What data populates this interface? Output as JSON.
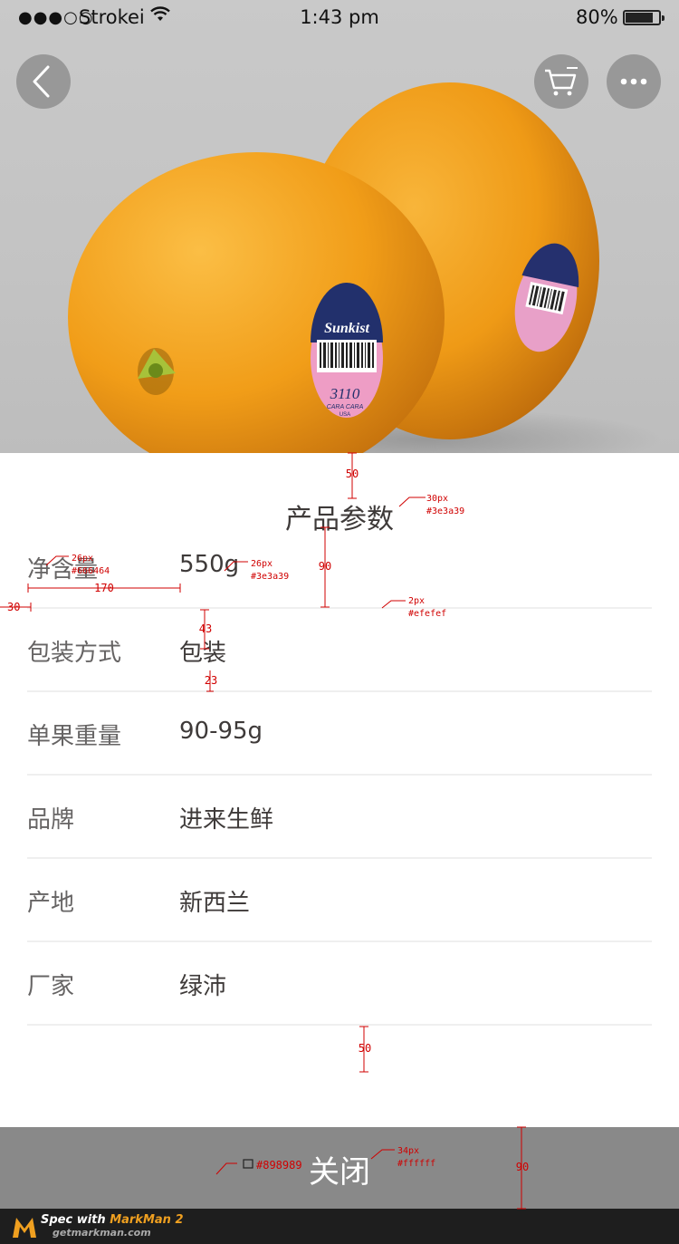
{
  "status_bar": {
    "signal": "●●●○○",
    "carrier": "Strokei",
    "time": "1:43 pm",
    "battery": "80%"
  },
  "hero": {
    "label_brand": "Sunkist",
    "label_code": "3110",
    "label_variety": "CARA CARA",
    "label_origin": "USA"
  },
  "header_buttons": [
    "back-icon",
    "cart-icon",
    "more-icon"
  ],
  "sheet": {
    "title": "产品参数",
    "rows": [
      {
        "label": "净含量",
        "value": "550g"
      },
      {
        "label": "包装方式",
        "value": "包装"
      },
      {
        "label": "单果重量",
        "value": "90-95g"
      },
      {
        "label": "品牌",
        "value": "进来生鲜"
      },
      {
        "label": "产地",
        "value": "新西兰"
      },
      {
        "label": "厂家",
        "value": "绿沛"
      }
    ]
  },
  "close_button": {
    "label": "关闭"
  },
  "footer": {
    "line1_prefix": "Spec with",
    "line1_brand": "MarkMan 2",
    "line2": "getmarkman.com"
  },
  "annotations": {
    "top_gap": "50",
    "title_spec_size": "30px",
    "title_spec_color": "#3e3a39",
    "title_row_gap": "90",
    "label_spec_size": "26px",
    "label_spec_color": "#666464",
    "value_spec_size": "26px",
    "value_spec_color": "#3e3a39",
    "value_offset": "170",
    "side_margin": "30",
    "divider_spec_size": "2px",
    "divider_spec_color": "#efefef",
    "value_top_gap": "43",
    "value_bottom_gap": "23",
    "bottom_gap": "50",
    "close_bg_color": "#898989",
    "close_spec_size": "34px",
    "close_spec_color": "#ffffff",
    "close_height": "90"
  },
  "colors": {
    "title": "#3e3a39",
    "label": "#666464",
    "value": "#3e3a39",
    "divider": "#efefef",
    "close_bg": "#898989",
    "close_text": "#ffffff",
    "annotation": "#d00000"
  }
}
